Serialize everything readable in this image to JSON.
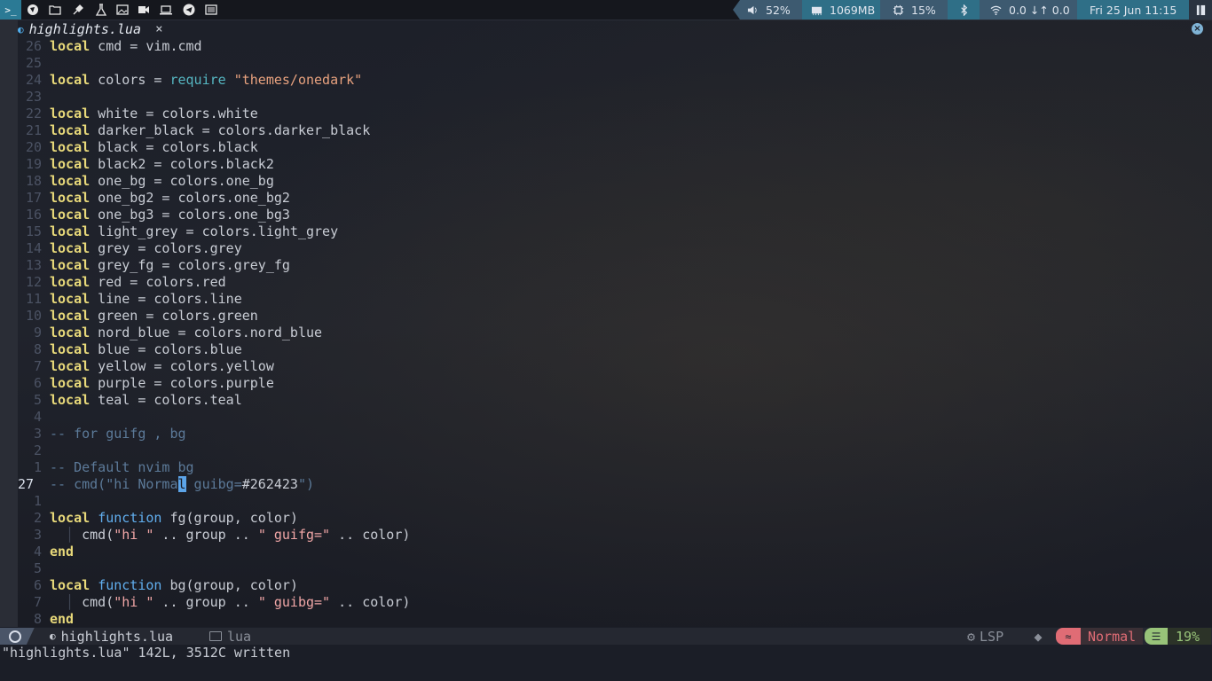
{
  "topbar": {
    "volume": "52%",
    "memory": "1069MB",
    "cpu": "15%",
    "network": "0.0 ↓↑ 0.0",
    "clock": "Fri 25 Jun 11:15"
  },
  "tab": {
    "filename": "highlights.lua",
    "close_glyph": "×"
  },
  "code_lines": [
    {
      "n": "26",
      "parts": [
        [
          "kw",
          "local"
        ],
        [
          "plain",
          " cmd = vim.cmd"
        ]
      ]
    },
    {
      "n": "25",
      "parts": []
    },
    {
      "n": "24",
      "parts": [
        [
          "kw",
          "local"
        ],
        [
          "plain",
          " colors = "
        ],
        [
          "req",
          "require"
        ],
        [
          "plain",
          " "
        ],
        [
          "str",
          "\"themes/onedark\""
        ]
      ]
    },
    {
      "n": "23",
      "parts": []
    },
    {
      "n": "22",
      "parts": [
        [
          "kw",
          "local"
        ],
        [
          "plain",
          " white = colors.white"
        ]
      ]
    },
    {
      "n": "21",
      "parts": [
        [
          "kw",
          "local"
        ],
        [
          "plain",
          " darker_black = colors.darker_black"
        ]
      ]
    },
    {
      "n": "20",
      "parts": [
        [
          "kw",
          "local"
        ],
        [
          "plain",
          " black = colors.black"
        ]
      ]
    },
    {
      "n": "19",
      "parts": [
        [
          "kw",
          "local"
        ],
        [
          "plain",
          " black2 = colors.black2"
        ]
      ]
    },
    {
      "n": "18",
      "parts": [
        [
          "kw",
          "local"
        ],
        [
          "plain",
          " one_bg = colors.one_bg"
        ]
      ]
    },
    {
      "n": "17",
      "parts": [
        [
          "kw",
          "local"
        ],
        [
          "plain",
          " one_bg2 = colors.one_bg2"
        ]
      ]
    },
    {
      "n": "16",
      "parts": [
        [
          "kw",
          "local"
        ],
        [
          "plain",
          " one_bg3 = colors.one_bg3"
        ]
      ]
    },
    {
      "n": "15",
      "parts": [
        [
          "kw",
          "local"
        ],
        [
          "plain",
          " light_grey = colors.light_grey"
        ]
      ]
    },
    {
      "n": "14",
      "parts": [
        [
          "kw",
          "local"
        ],
        [
          "plain",
          " grey = colors.grey"
        ]
      ]
    },
    {
      "n": "13",
      "parts": [
        [
          "kw",
          "local"
        ],
        [
          "plain",
          " grey_fg = colors.grey_fg"
        ]
      ]
    },
    {
      "n": "12",
      "parts": [
        [
          "kw",
          "local"
        ],
        [
          "plain",
          " red = colors.red"
        ]
      ]
    },
    {
      "n": "11",
      "parts": [
        [
          "kw",
          "local"
        ],
        [
          "plain",
          " line = colors.line"
        ]
      ]
    },
    {
      "n": "10",
      "parts": [
        [
          "kw",
          "local"
        ],
        [
          "plain",
          " green = colors.green"
        ]
      ]
    },
    {
      "n": "9",
      "parts": [
        [
          "kw",
          "local"
        ],
        [
          "plain",
          " nord_blue = colors.nord_blue"
        ]
      ]
    },
    {
      "n": "8",
      "parts": [
        [
          "kw",
          "local"
        ],
        [
          "plain",
          " blue = colors.blue"
        ]
      ]
    },
    {
      "n": "7",
      "parts": [
        [
          "kw",
          "local"
        ],
        [
          "plain",
          " yellow = colors.yellow"
        ]
      ]
    },
    {
      "n": "6",
      "parts": [
        [
          "kw",
          "local"
        ],
        [
          "plain",
          " purple = colors.purple"
        ]
      ]
    },
    {
      "n": "5",
      "parts": [
        [
          "kw",
          "local"
        ],
        [
          "plain",
          " teal = colors.teal"
        ]
      ]
    },
    {
      "n": "4",
      "parts": []
    },
    {
      "n": "3",
      "parts": [
        [
          "cmt",
          "-- for guifg , bg"
        ]
      ]
    },
    {
      "n": "2",
      "parts": []
    },
    {
      "n": "1",
      "parts": [
        [
          "cmt",
          "-- Default nvim bg"
        ]
      ]
    },
    {
      "n": "27",
      "cur": true,
      "parts": [
        [
          "cmt",
          "-- cmd(\"hi Norma"
        ],
        [
          "cursor",
          "l"
        ],
        [
          "cmt",
          " guibg="
        ],
        [
          "plain",
          "#262423"
        ],
        [
          "cmt",
          "\")"
        ]
      ]
    },
    {
      "n": "1",
      "parts": []
    },
    {
      "n": "2",
      "parts": [
        [
          "kw",
          "local"
        ],
        [
          "plain",
          " "
        ],
        [
          "kwf",
          "function"
        ],
        [
          "plain",
          " fg(group, color)"
        ]
      ]
    },
    {
      "n": "3",
      "parts": [
        [
          "guide",
          "  │ "
        ],
        [
          "plain",
          "cmd("
        ],
        [
          "str2",
          "\"hi \""
        ],
        [
          "plain",
          " .. group .. "
        ],
        [
          "str2",
          "\" guifg=\""
        ],
        [
          "plain",
          " .. color)"
        ]
      ]
    },
    {
      "n": "4",
      "parts": [
        [
          "kw",
          "end"
        ]
      ]
    },
    {
      "n": "5",
      "parts": []
    },
    {
      "n": "6",
      "parts": [
        [
          "kw",
          "local"
        ],
        [
          "plain",
          " "
        ],
        [
          "kwf",
          "function"
        ],
        [
          "plain",
          " bg(group, color)"
        ]
      ]
    },
    {
      "n": "7",
      "parts": [
        [
          "guide",
          "  │ "
        ],
        [
          "plain",
          "cmd("
        ],
        [
          "str2",
          "\"hi \""
        ],
        [
          "plain",
          " .. group .. "
        ],
        [
          "str2",
          "\" guibg=\""
        ],
        [
          "plain",
          " .. color)"
        ]
      ]
    },
    {
      "n": "8",
      "parts": [
        [
          "kw",
          "end"
        ]
      ]
    }
  ],
  "statusline": {
    "filename": "highlights.lua",
    "directory": "lua",
    "lsp": "LSP",
    "mode": "Normal",
    "percent": "19%"
  },
  "cmdline": {
    "message": "\"highlights.lua\" 142L, 3512C written"
  }
}
